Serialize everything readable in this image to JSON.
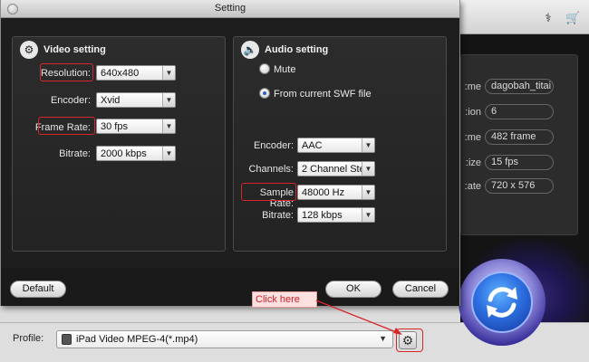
{
  "dialog": {
    "title": "Setting",
    "video": {
      "title": "Video setting",
      "icon": "film-reel-icon",
      "resolution": {
        "label": "Resolution:",
        "value": "640x480"
      },
      "encoder": {
        "label": "Encoder:",
        "value": "Xvid"
      },
      "frame_rate": {
        "label": "Frame Rate:",
        "value": "30 fps"
      },
      "bitrate": {
        "label": "Bitrate:",
        "value": "2000 kbps"
      }
    },
    "audio": {
      "title": "Audio setting",
      "icon": "speaker-icon",
      "mute_label": "Mute",
      "source_label": "From current SWF file",
      "selected_option": "From current SWF file",
      "encoder": {
        "label": "Encoder:",
        "value": "AAC"
      },
      "channels": {
        "label": "Channels:",
        "value": "2 Channel Ster"
      },
      "sample_rate": {
        "label": "Sample Rate:",
        "value": "48000 Hz"
      },
      "bitrate": {
        "label": "Bitrate:",
        "value": "128 kbps"
      }
    },
    "buttons": {
      "default": "Default",
      "ok": "OK",
      "cancel": "Cancel"
    }
  },
  "background": {
    "info": [
      {
        "label": "me:",
        "value": "dagobah_titai"
      },
      {
        "label": "ion:",
        "value": "6"
      },
      {
        "label": "me:",
        "value": "482 frame"
      },
      {
        "label": "ize:",
        "value": "15 fps"
      },
      {
        "label": "ate:",
        "value": "720 x 576"
      }
    ],
    "profile_label": "Profile:",
    "profile_value": "iPad Video MPEG-4(*.mp4)",
    "icons": [
      "broom-icon",
      "cart-icon",
      "gear-icon",
      "convert-icon"
    ]
  },
  "annotation": {
    "text": "Click here",
    "color": "#d6262a"
  },
  "colors": {
    "highlight": "#d6262a",
    "panel_bg": "#2c2c2c",
    "dialog_bg": "#1e1e1e"
  }
}
